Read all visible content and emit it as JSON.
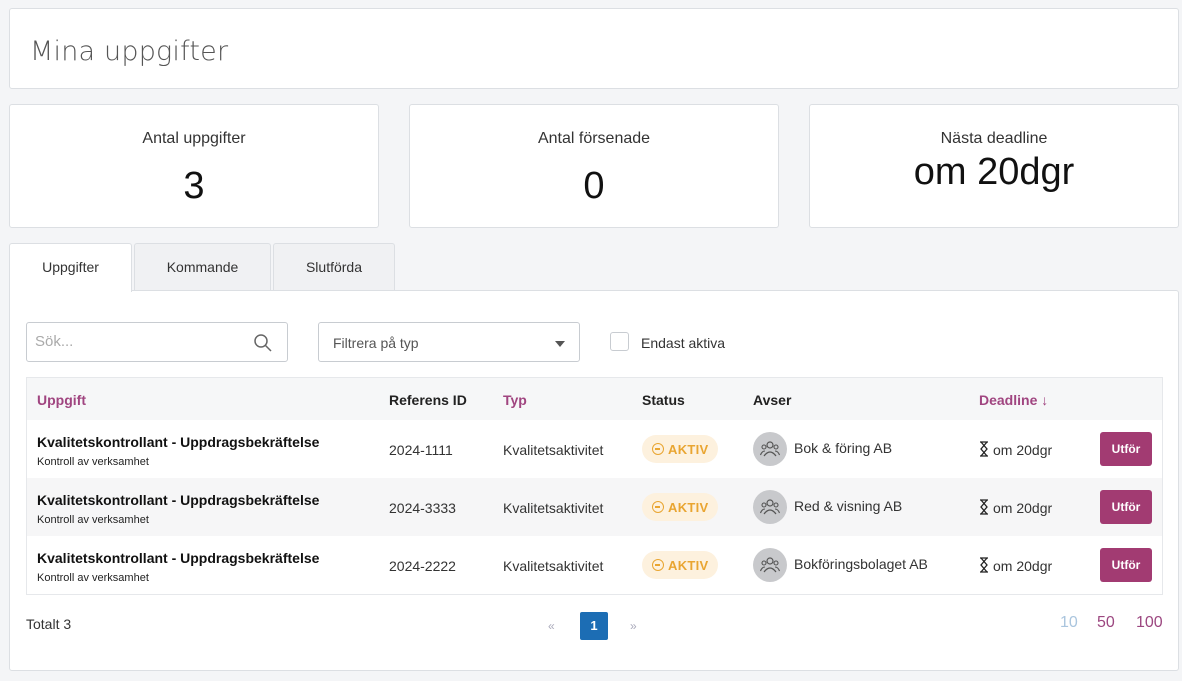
{
  "page": {
    "title": "Mina uppgifter"
  },
  "stats": [
    {
      "label": "Antal uppgifter",
      "value": "3"
    },
    {
      "label": "Antal försenade",
      "value": "0"
    },
    {
      "label": "Nästa deadline",
      "value": "om 20dgr"
    }
  ],
  "tabs": [
    {
      "label": "Uppgifter",
      "active": true
    },
    {
      "label": "Kommande",
      "active": false
    },
    {
      "label": "Slutförda",
      "active": false
    }
  ],
  "filters": {
    "search_placeholder": "Sök...",
    "type_placeholder": "Filtrera på typ",
    "only_active_label": "Endast aktiva"
  },
  "table": {
    "headers": {
      "uppgift": "Uppgift",
      "referens": "Referens ID",
      "typ": "Typ",
      "status": "Status",
      "avser": "Avser",
      "deadline": "Deadline ↓"
    },
    "rows": [
      {
        "title": "Kvalitetskontrollant - Uppdragsbekräftelse",
        "subtitle": "Kontroll av verksamhet",
        "ref": "2024-1111",
        "type": "Kvalitetsaktivitet",
        "status": "AKTIV",
        "avser": "Bok & föring AB",
        "deadline": "om 20dgr",
        "action": "Utför"
      },
      {
        "title": "Kvalitetskontrollant - Uppdragsbekräftelse",
        "subtitle": "Kontroll av verksamhet",
        "ref": "2024-3333",
        "type": "Kvalitetsaktivitet",
        "status": "AKTIV",
        "avser": "Red & visning AB",
        "deadline": "om 20dgr",
        "action": "Utför"
      },
      {
        "title": "Kvalitetskontrollant - Uppdragsbekräftelse",
        "subtitle": "Kontroll av verksamhet",
        "ref": "2024-2222",
        "type": "Kvalitetsaktivitet",
        "status": "AKTIV",
        "avser": "Bokföringsbolaget AB",
        "deadline": "om 20dgr",
        "action": "Utför"
      }
    ]
  },
  "footer": {
    "total": "Totalt 3",
    "prev": "«",
    "current_page": "1",
    "next": "»",
    "page_sizes": [
      "10",
      "50",
      "100"
    ]
  },
  "colors": {
    "accent": "#a23b72",
    "header_link": "#a04580",
    "status": "#e9a531",
    "status_bg": "#fdf1de",
    "page_active": "#1c6db4"
  }
}
